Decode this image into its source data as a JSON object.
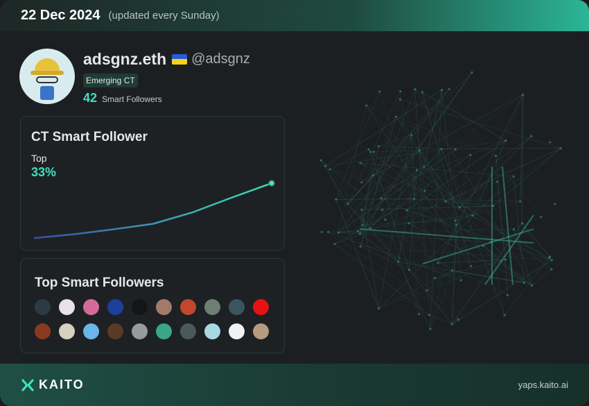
{
  "header": {
    "date": "22 Dec 2024",
    "updated": "(updated every Sunday)"
  },
  "profile": {
    "name": "adsgnz.eth",
    "flag": "ukraine-flag-icon",
    "handle": "@adsgnz",
    "tag": "Emerging CT",
    "smart_followers_count": "42",
    "smart_followers_label": "Smart Followers"
  },
  "ct_panel": {
    "title": "CT Smart Follower",
    "top_label": "Top",
    "top_percent": "33%",
    "trend": [
      0.0,
      0.07,
      0.16,
      0.26,
      0.47,
      0.74,
      1.0
    ],
    "line_gradient": [
      "#3a4fa8",
      "#3fe0be"
    ]
  },
  "followers_panel": {
    "title": "Top Smart Followers",
    "row1_colors": [
      "#2a3b44",
      "#e8e0ea",
      "#d46a9a",
      "#1d3f9a",
      "#151515",
      "#a27a6a",
      "#c2472e",
      "#6f7e73",
      "#3b5560",
      "#e81212"
    ],
    "row2_colors": [
      "#8a3a1e",
      "#d8d0c0",
      "#6ab6e8",
      "#5a3a24",
      "#9a9a9a",
      "#3aa58a",
      "#4a5a5a",
      "#a8d8e0",
      "#f2f2f2",
      "#b89a80"
    ]
  },
  "footer": {
    "brand": "KAITO",
    "site": "yaps.kaito.ai"
  },
  "colors": {
    "accent": "#3fe0be",
    "panel_border": "#273a35"
  }
}
